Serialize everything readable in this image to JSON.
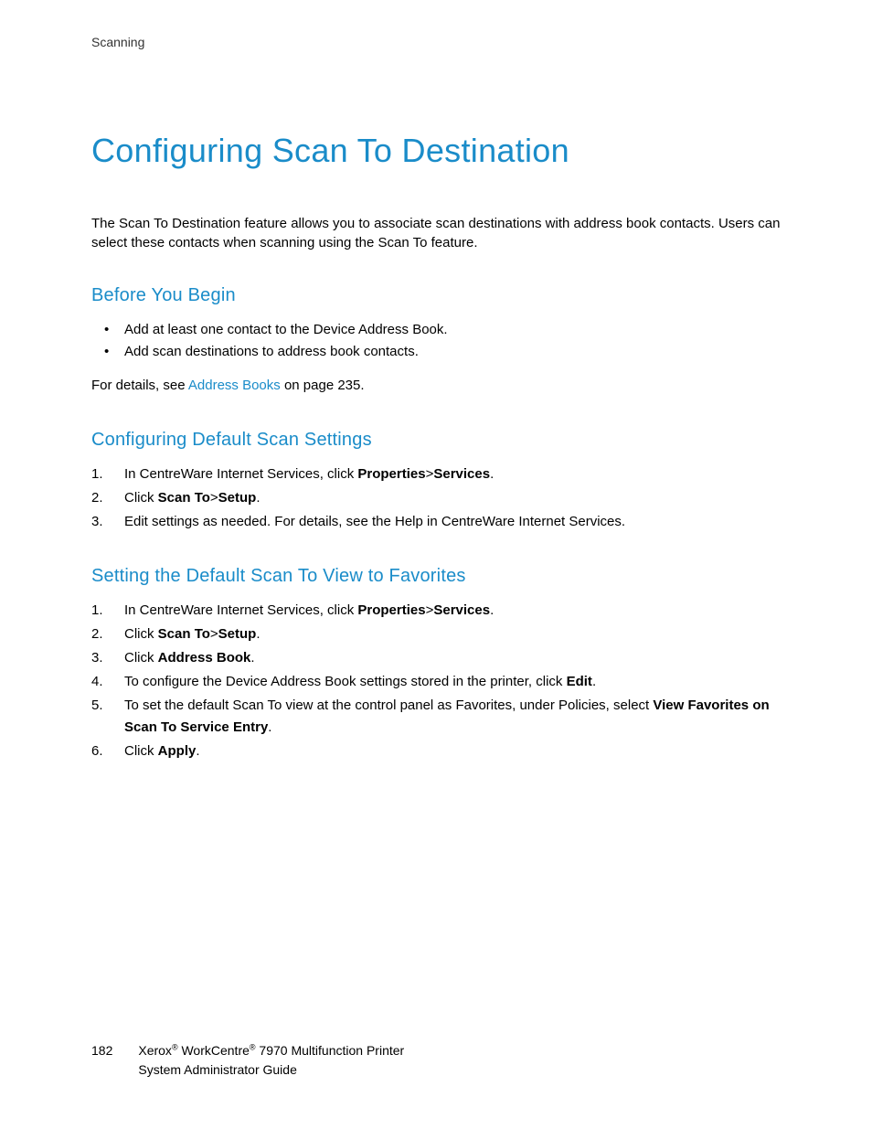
{
  "header": {
    "running_title": "Scanning"
  },
  "page_title": "Configuring Scan To Destination",
  "intro": "The Scan To Destination feature allows you to associate scan destinations with address book contacts. Users can select these contacts when scanning using the Scan To feature.",
  "section_before": {
    "heading": "Before You Begin",
    "bullets": [
      "Add at least one contact to the Device Address Book.",
      "Add scan destinations to address book contacts."
    ],
    "details_prefix": "For details, see ",
    "details_link": "Address Books",
    "details_suffix": " on page 235."
  },
  "section_defaults": {
    "heading": "Configuring Default Scan Settings",
    "step1_pre": "In CentreWare Internet Services, click ",
    "step1_bold1": "Properties",
    "step1_mid": ">",
    "step1_bold2": "Services",
    "step1_post": ".",
    "step2_pre": "Click ",
    "step2_bold1": "Scan To",
    "step2_mid": ">",
    "step2_bold2": "Setup",
    "step2_post": ".",
    "step3": "Edit settings as needed. For details, see the Help in CentreWare Internet Services."
  },
  "section_favorites": {
    "heading": "Setting the Default Scan To View to Favorites",
    "step1_pre": "In CentreWare Internet Services, click ",
    "step1_bold1": "Properties",
    "step1_mid": ">",
    "step1_bold2": "Services",
    "step1_post": ".",
    "step2_pre": "Click ",
    "step2_bold1": "Scan To",
    "step2_mid": ">",
    "step2_bold2": "Setup",
    "step2_post": ".",
    "step3_pre": "Click ",
    "step3_bold": "Address Book",
    "step3_post": ".",
    "step4_pre": "To configure the Device Address Book settings stored in the printer, click ",
    "step4_bold": "Edit",
    "step4_post": ".",
    "step5_pre": "To set the default Scan To view at the control panel as Favorites, under Policies, select ",
    "step5_bold": "View Favorites on Scan To Service Entry",
    "step5_post": ".",
    "step6_pre": "Click ",
    "step6_bold": "Apply",
    "step6_post": "."
  },
  "footer": {
    "page_num": "182",
    "brand1": "Xerox",
    "reg": "®",
    "brand2": " WorkCentre",
    "model": " 7970 Multifunction Printer",
    "line2": "System Administrator Guide"
  }
}
